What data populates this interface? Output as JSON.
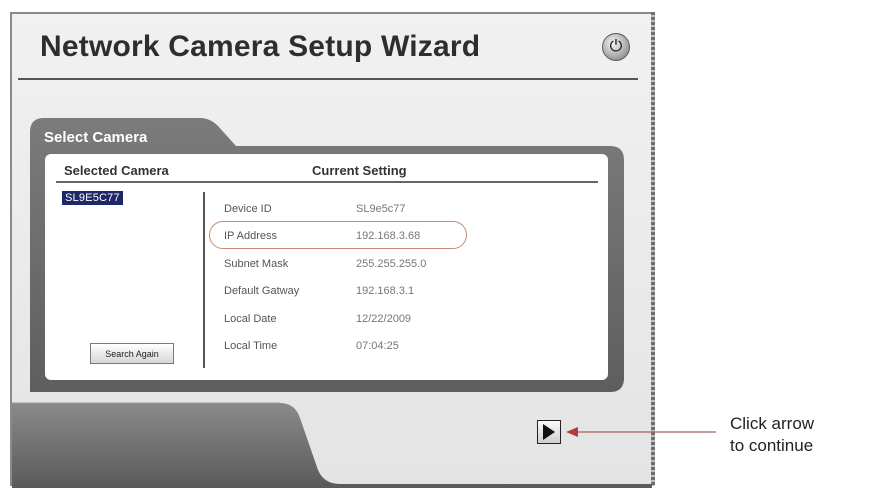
{
  "wizard": {
    "title": "Network Camera Setup Wizard",
    "power_icon": "power-icon",
    "panel_title": "Select Camera"
  },
  "table": {
    "col_selected": "Selected Camera",
    "col_current": "Current Setting"
  },
  "cameras": [
    "SL9E5C77"
  ],
  "settings": [
    {
      "label": "Device ID",
      "value": "SL9e5c77"
    },
    {
      "label": "IP Address",
      "value": "192.168.3.68"
    },
    {
      "label": "Subnet Mask",
      "value": "255.255.255.0"
    },
    {
      "label": "Default Gatway",
      "value": "192.168.3.1"
    },
    {
      "label": "Local Date",
      "value": "12/22/2009"
    },
    {
      "label": "Local Time",
      "value": "07:04:25"
    }
  ],
  "buttons": {
    "search_again": "Search Again",
    "next_icon": "play-arrow-icon"
  },
  "callout": {
    "line1": "Click arrow",
    "line2": "to continue"
  },
  "colors": {
    "panel_dark": "#6d6d6d",
    "selection": "#1e2768",
    "highlight_ring": "#c98a6e",
    "callout_arrow": "#b53a3a"
  }
}
